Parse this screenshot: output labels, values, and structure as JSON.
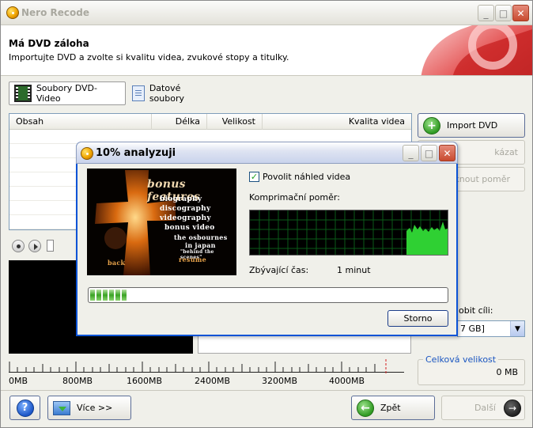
{
  "app": {
    "title": "Nero Recode",
    "header_title": "Má DVD záloha",
    "header_desc": "Importujte DVD a zvolte si kvalitu videa, zvukové stopy a titulky.",
    "accent_color": "#d42020"
  },
  "tabs": [
    {
      "label": "Soubory DVD-Video",
      "icon": "film-icon",
      "active": true
    },
    {
      "label": "Datové soubory",
      "icon": "document-icon",
      "active": false
    }
  ],
  "table": {
    "columns": [
      "Obsah",
      "Délka",
      "Velikost",
      "Kvalita videa"
    ]
  },
  "right_panel": {
    "import_label": "Import DVD",
    "btn2_visible": "kázat",
    "btn3_visible": "mknout poměr",
    "target_label_visible": "obit cíli:",
    "target_value_visible": "7 GB]",
    "total_size_label": "Celková velikost",
    "total_size_value": "0 MB"
  },
  "ruler": {
    "labels": [
      "0MB",
      "800MB",
      "1600MB",
      "2400MB",
      "3200MB",
      "4000MB"
    ]
  },
  "bottom": {
    "help_label": "?",
    "more_label": "Více >>",
    "back_label": "Zpět",
    "next_label": "Další"
  },
  "dialog": {
    "title": "10% analyzuji",
    "preview_enabled_label": "Povolit náhled videa",
    "preview_checked": true,
    "compression_label": "Komprimační poměr:",
    "remaining_label": "Zbývající čas:",
    "remaining_value": "1 minut",
    "progress_fraction": 0.1,
    "cancel_label": "Storno",
    "menu": {
      "title": "bonus features",
      "items": [
        "biography",
        "discography",
        "videography",
        "bonus video",
        "the osbournes",
        "in japan",
        "\"behind the scenes\""
      ],
      "back": "back",
      "resume": "resume"
    }
  }
}
